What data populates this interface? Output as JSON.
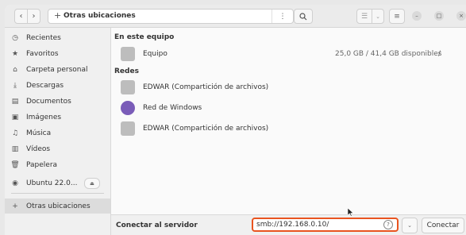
{
  "header": {
    "path_label": "Otras ubicaciones",
    "path_icon": "plus-icon",
    "path_menu_icon": "kebab-icon"
  },
  "sidebar": {
    "items": [
      {
        "icon": "clock-icon",
        "label": "Recientes"
      },
      {
        "icon": "star-icon",
        "label": "Favoritos"
      },
      {
        "icon": "home-icon",
        "label": "Carpeta personal"
      },
      {
        "icon": "download-icon",
        "label": "Descargas"
      },
      {
        "icon": "document-icon",
        "label": "Documentos"
      },
      {
        "icon": "image-icon",
        "label": "Imágenes"
      },
      {
        "icon": "music-icon",
        "label": "Música"
      },
      {
        "icon": "video-icon",
        "label": "Vídeos"
      },
      {
        "icon": "trash-icon",
        "label": "Papelera"
      },
      {
        "icon": "disc-icon",
        "label": "Ubuntu 22.0..."
      },
      {
        "icon": "plus-icon",
        "label": "Otras ubicaciones"
      }
    ]
  },
  "content": {
    "this_computer_heading": "En este equipo",
    "computer": {
      "label": "Equipo",
      "info": "25,0 GB / 41,4 GB disponibles",
      "separator": "/"
    },
    "networks_heading": "Redes",
    "networks": [
      {
        "label": "EDWAR (Compartición de archivos)"
      },
      {
        "label": "Red de Windows"
      },
      {
        "label": "EDWAR (Compartición de archivos)"
      }
    ]
  },
  "bottom": {
    "connect_label": "Conectar al servidor",
    "server_value": "smb://192.168.0.10/",
    "connect_button": "Conectar"
  },
  "colors": {
    "accent": "#e95420"
  }
}
